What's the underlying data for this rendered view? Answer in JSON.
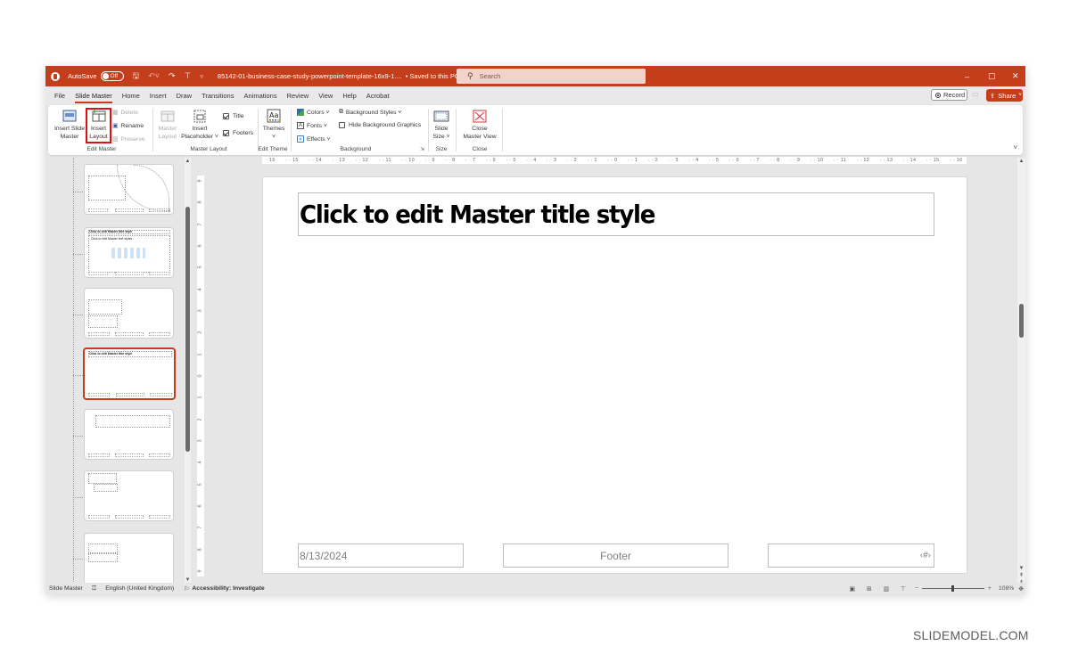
{
  "titlebar": {
    "autosave_label": "AutoSave",
    "autosave_state": "Off",
    "filename": "85142-01-business-case-study-powerpoint-template-16x9-1....",
    "save_status": "• Saved to this PC",
    "search_placeholder": "Search",
    "icons": [
      "save-icon",
      "undo-icon",
      "redo-icon",
      "present-icon",
      "customize-icon"
    ],
    "minimize": "–",
    "restore": "▢",
    "close": "✕"
  },
  "menubar": {
    "items": [
      "File",
      "Slide Master",
      "Home",
      "Insert",
      "Draw",
      "Transitions",
      "Animations",
      "Review",
      "View",
      "Help",
      "Acrobat"
    ],
    "active": "Slide Master",
    "record_label": "Record",
    "share_label": "Share"
  },
  "ribbon": {
    "edit_master": {
      "label": "Edit Master",
      "insert_slide_master": "Insert Slide Master",
      "insert_slide_master_l1": "Insert Slide",
      "insert_slide_master_l2": "Master",
      "insert_layout_l1": "Insert",
      "insert_layout_l2": "Layout",
      "delete": "Delete",
      "rename": "Rename",
      "preserve": "Preserve"
    },
    "master_layout": {
      "label": "Master Layout",
      "master_layout_l1": "Master",
      "master_layout_l2": "Layout",
      "insert_placeholder_l1": "Insert",
      "insert_placeholder_l2": "Placeholder ˅",
      "title": "Title",
      "title_checked": true,
      "footers": "Footers",
      "footers_checked": true
    },
    "edit_theme": {
      "label": "Edit Theme",
      "themes": "Themes",
      "themes_arrow": "˅"
    },
    "background": {
      "label": "Background",
      "colors": "Colors ˅",
      "fonts": "Fonts ˅",
      "effects": "Effects ˅",
      "background_styles": "Background Styles ˅",
      "hide_background_graphics": "Hide Background Graphics",
      "hide_checked": false
    },
    "size": {
      "label": "Size",
      "slide_size_l1": "Slide",
      "slide_size_l2": "Size ˅"
    },
    "close": {
      "label": "Close",
      "close_master_l1": "Close",
      "close_master_l2": "Master View"
    }
  },
  "ruler": {
    "horizontal": [
      "16",
      "15",
      "14",
      "13",
      "12",
      "11",
      "10",
      "9",
      "8",
      "7",
      "6",
      "5",
      "4",
      "3",
      "2",
      "1",
      "0",
      "1",
      "2",
      "3",
      "4",
      "5",
      "6",
      "7",
      "8",
      "9",
      "10",
      "11",
      "12",
      "13",
      "14",
      "15",
      "16"
    ],
    "vertical": [
      "9",
      "8",
      "7",
      "6",
      "5",
      "4",
      "3",
      "2",
      "1",
      "0",
      "1",
      "2",
      "3",
      "4",
      "5",
      "6",
      "7",
      "8",
      "9"
    ]
  },
  "thumbnails": {
    "items": [
      {
        "type": "section-header"
      },
      {
        "type": "title-and-content",
        "title": "Click to edit Master title style",
        "body": "Click to edit Master text styles"
      },
      {
        "type": "two-boxes"
      },
      {
        "type": "title-only",
        "title": "Click to edit Master title style",
        "selected": true
      },
      {
        "type": "wide-box"
      },
      {
        "type": "offset-boxes"
      },
      {
        "type": "two-stacked"
      }
    ]
  },
  "slide": {
    "title": "Click to edit Master title style",
    "date": "8/13/2024",
    "footer": "Footer",
    "slide_number": "‹#›"
  },
  "statusbar": {
    "view": "Slide Master",
    "language": "English (United Kingdom)",
    "accessibility": "Accessibility: Investigate",
    "zoom_level": "108%",
    "zoom_fraction": 0.5
  },
  "watermark": "SLIDEMODEL.COM"
}
